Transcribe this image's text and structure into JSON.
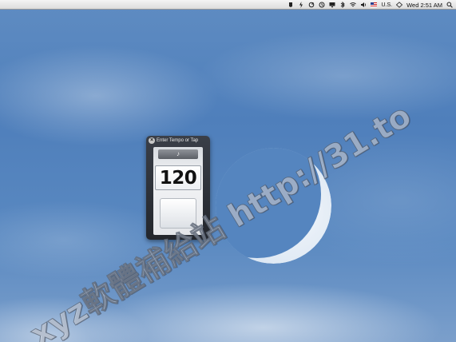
{
  "menubar": {
    "input_source": "U.S.",
    "clock": "Wed 2:51 AM",
    "icons": [
      "script-icon",
      "power-icon",
      "sync-icon",
      "time-machine-icon",
      "display-icon",
      "bluetooth-icon",
      "wifi-icon",
      "volume-icon",
      "flag-icon",
      "user-icon",
      "spotlight-icon"
    ]
  },
  "widget": {
    "title": "Enter Tempo or Tap",
    "note_symbol": "♪",
    "tempo": "120",
    "close_symbol": "×"
  },
  "watermark": {
    "text": "xyz軟體補給站 http://31.to"
  },
  "colors": {
    "sky": "#5583bf",
    "widget_frame": "#2b2f36",
    "menubar": "#e8e8e8"
  }
}
